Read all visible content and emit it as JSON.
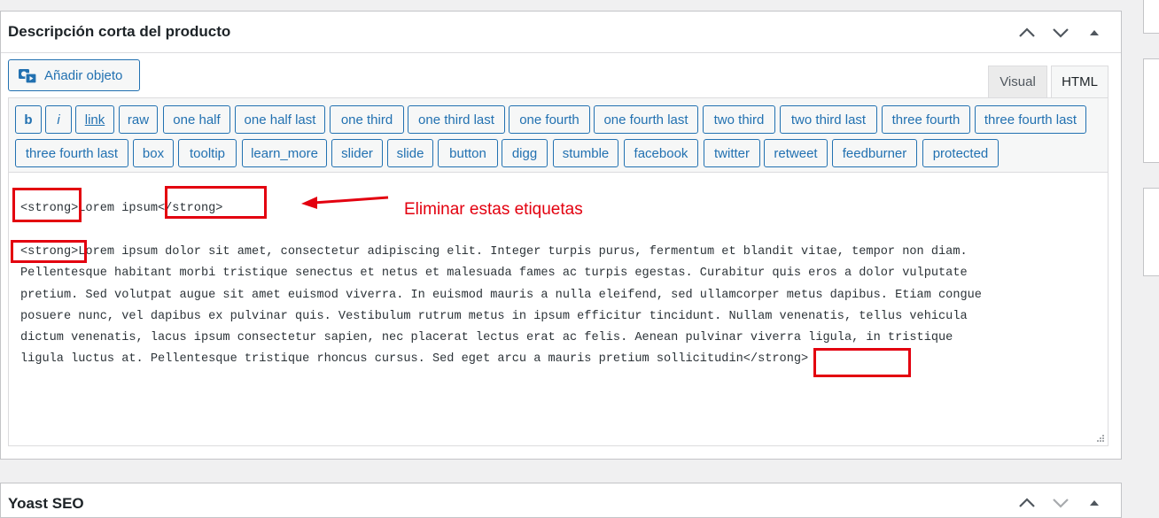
{
  "panel": {
    "title": "Descripción corta del producto",
    "media_button": "Añadir objeto",
    "tabs": [
      "Visual",
      "HTML"
    ],
    "active_tab": "HTML"
  },
  "toolbar": {
    "row1": [
      "b",
      "i",
      "link",
      "raw",
      "one half",
      "one half last",
      "one third",
      "one third last",
      "one fourth",
      "one fourth last",
      "two third",
      "two third last",
      "three fourth",
      "three fourth last"
    ],
    "row2": [
      "three fourth last",
      "box",
      "tooltip",
      "learn_more",
      "slider",
      "slide",
      "button",
      "digg",
      "stumble",
      "facebook",
      "twitter",
      "retweet",
      "feedburner",
      "protected"
    ]
  },
  "editor": {
    "line1": "<strong>Lorem ipsum</strong>",
    "paragraph_lines": [
      "<strong>Lorem ipsum dolor sit amet, consectetur adipiscing elit. Integer turpis purus, fermentum et blandit vitae, tempor non diam.",
      "Pellentesque habitant morbi tristique senectus et netus et malesuada fames ac turpis egestas. Curabitur quis eros a dolor vulputate",
      "pretium. Sed volutpat augue sit amet euismod viverra. In euismod mauris a nulla eleifend, sed ullamcorper metus dapibus. Etiam congue",
      "posuere nunc, vel dapibus ex pulvinar quis. Vestibulum rutrum metus in ipsum efficitur tincidunt. Nullam venenatis, tellus vehicula",
      "dictum venenatis, lacus ipsum consectetur sapien, nec placerat lectus erat ac felis. Aenean pulvinar viverra ligula, in tristique",
      "ligula luctus at. Pellentesque tristique rhoncus cursus. Sed eget arcu a mauris pretium sollicitudin</strong>"
    ]
  },
  "annotation": {
    "text": "Eliminar estas etiquetas",
    "color": "#e3000f"
  },
  "panel2": {
    "title": "Yoast SEO"
  },
  "colors": {
    "accent": "#2271b1",
    "border": "#c3c4c7",
    "background": "#f0f0f1"
  },
  "icons": [
    "media-icon",
    "chevron-up-icon",
    "chevron-down-icon",
    "triangle-up-icon",
    "resize-grip-icon"
  ]
}
